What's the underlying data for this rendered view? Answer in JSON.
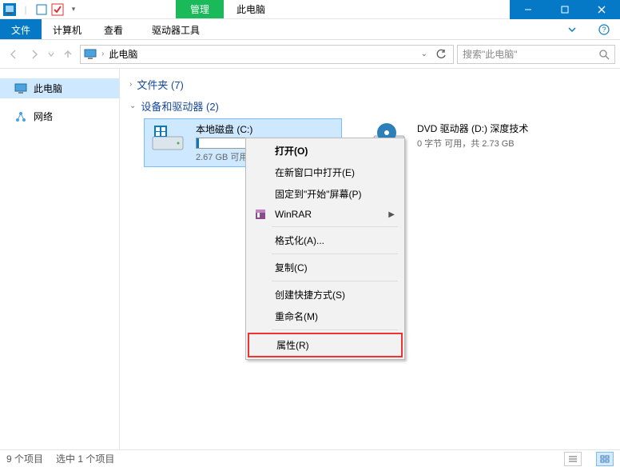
{
  "titlebar": {
    "manage_tab": "管理",
    "window_title": "此电脑"
  },
  "ribbon": {
    "file": "文件",
    "computer": "计算机",
    "view": "查看",
    "drive_tools": "驱动器工具"
  },
  "nav": {
    "breadcrumb": "此电脑",
    "search_placeholder": "搜索\"此电脑\""
  },
  "sidebar": {
    "this_pc": "此电脑",
    "network": "网络"
  },
  "groups": {
    "folders": "文件夹 (7)",
    "devices": "设备和驱动器 (2)"
  },
  "drives": {
    "c": {
      "name": "本地磁盘 (C:)",
      "subtitle": "2.67 GB 可用"
    },
    "d": {
      "name": "DVD 驱动器 (D:) 深度技术",
      "subtitle": "0 字节 可用，共 2.73 GB"
    }
  },
  "context_menu": {
    "open": "打开(O)",
    "open_new_window": "在新窗口中打开(E)",
    "pin_start": "固定到\"开始\"屏幕(P)",
    "winrar": "WinRAR",
    "format": "格式化(A)...",
    "copy": "复制(C)",
    "create_shortcut": "创建快捷方式(S)",
    "rename": "重命名(M)",
    "properties": "属性(R)"
  },
  "statusbar": {
    "items": "9 个项目",
    "selected": "选中 1 个项目"
  }
}
